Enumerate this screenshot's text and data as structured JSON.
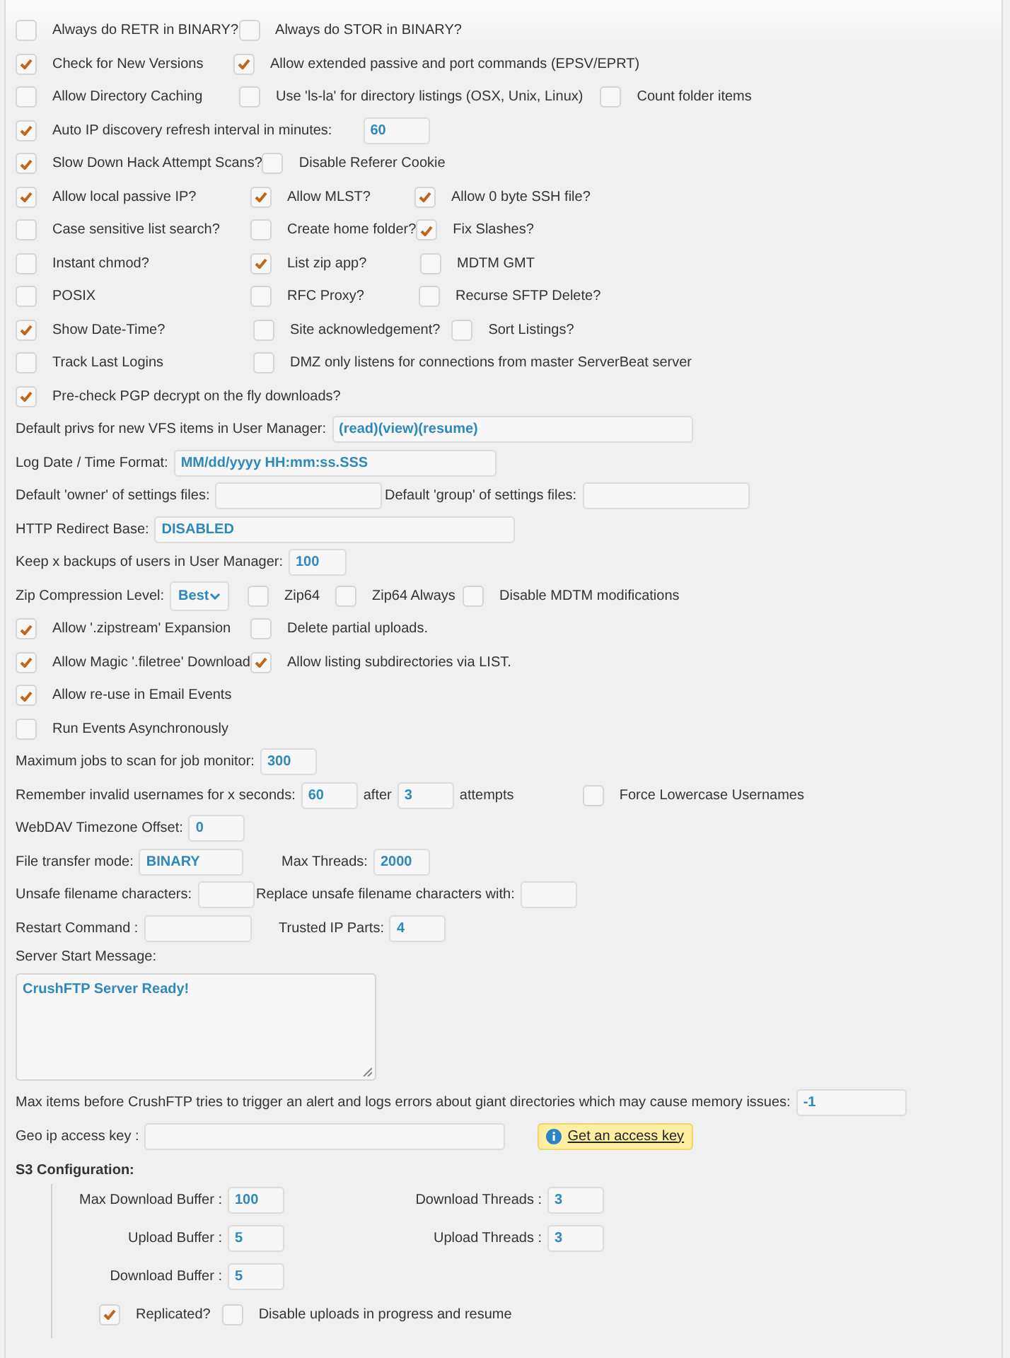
{
  "rows": [
    {
      "items": [
        {
          "kind": "checkbox",
          "label": "Always do RETR in BINARY?",
          "checked": false
        },
        {
          "kind": "checkbox",
          "label": "Always do STOR in BINARY?",
          "checked": false
        }
      ]
    },
    {
      "items": [
        {
          "kind": "checkbox",
          "label": "Check for New Versions",
          "checked": true
        },
        {
          "kind": "checkbox",
          "label": "Allow extended passive and port commands (EPSV/EPRT)",
          "checked": true
        }
      ]
    },
    {
      "items": [
        {
          "kind": "checkbox",
          "label": "Allow Directory Caching",
          "checked": false
        },
        {
          "kind": "checkbox",
          "label": "Use 'ls-la' for directory listings (OSX, Unix, Linux)",
          "checked": false
        },
        {
          "kind": "checkbox",
          "label": "Count folder items",
          "checked": false
        }
      ]
    },
    {
      "items": [
        {
          "kind": "checkbox",
          "label": "Auto IP discovery refresh interval in minutes:",
          "checked": true
        },
        {
          "kind": "field",
          "value": "60"
        }
      ]
    },
    {
      "items": [
        {
          "kind": "checkbox",
          "label": "Slow Down Hack Attempt Scans?",
          "checked": true
        },
        {
          "kind": "checkbox",
          "label": "Disable Referer Cookie",
          "checked": false
        }
      ]
    },
    {
      "items": [
        {
          "kind": "checkbox",
          "label": "Allow local passive IP?",
          "checked": true
        },
        {
          "kind": "checkbox",
          "label": "Allow MLST?",
          "checked": true
        },
        {
          "kind": "checkbox",
          "label": "Allow 0 byte SSH file?",
          "checked": true
        }
      ]
    },
    {
      "items": [
        {
          "kind": "checkbox",
          "label": "Case sensitive list search?",
          "checked": false
        },
        {
          "kind": "checkbox",
          "label": "Create home folder?",
          "checked": false
        },
        {
          "kind": "checkbox",
          "label": "Fix Slashes?",
          "checked": true
        }
      ]
    },
    {
      "items": [
        {
          "kind": "checkbox",
          "label": "Instant chmod?",
          "checked": false
        },
        {
          "kind": "checkbox",
          "label": "List zip app?",
          "checked": true
        },
        {
          "kind": "checkbox",
          "label": "MDTM GMT",
          "checked": false
        }
      ]
    },
    {
      "items": [
        {
          "kind": "checkbox",
          "label": "POSIX",
          "checked": false
        },
        {
          "kind": "checkbox",
          "label": "RFC Proxy?",
          "checked": false
        },
        {
          "kind": "checkbox",
          "label": "Recurse SFTP Delete?",
          "checked": false
        }
      ]
    },
    {
      "items": [
        {
          "kind": "checkbox",
          "label": "Show Date-Time?",
          "checked": true
        },
        {
          "kind": "checkbox",
          "label": "Site acknowledgement?",
          "checked": false
        },
        {
          "kind": "checkbox",
          "label": "Sort Listings?",
          "checked": false
        }
      ]
    },
    {
      "items": [
        {
          "kind": "checkbox",
          "label": "Track Last Logins",
          "checked": false
        },
        {
          "kind": "checkbox",
          "label": "DMZ only listens for connections from master ServerBeat server",
          "checked": false
        }
      ]
    },
    {
      "items": [
        {
          "kind": "checkbox",
          "label": "Pre-check PGP decrypt on the fly downloads?",
          "checked": true
        }
      ]
    },
    {
      "items": [
        {
          "kind": "field",
          "label": "Default privs for new VFS items in User Manager:",
          "value": "(read)(view)(resume)"
        }
      ]
    },
    {
      "items": [
        {
          "kind": "field",
          "label": "Log Date / Time Format:",
          "value": "MM/dd/yyyy HH:mm:ss.SSS"
        }
      ]
    },
    {
      "items": [
        {
          "kind": "field",
          "label": "Default 'owner' of settings files:"
        },
        {
          "kind": "field",
          "label": "Default 'group' of settings files:"
        }
      ]
    },
    {
      "items": [
        {
          "kind": "field",
          "label": "HTTP Redirect Base:",
          "value": "DISABLED"
        }
      ]
    },
    {
      "items": [
        {
          "kind": "field",
          "label": "Keep x backups of users in User Manager:",
          "value": "100"
        }
      ]
    },
    {
      "items": [
        {
          "kind": "select",
          "label": "Zip Compression Level:",
          "value": "Best"
        },
        {
          "kind": "checkbox",
          "label": "Zip64",
          "checked": false
        },
        {
          "kind": "checkbox",
          "label": "Zip64 Always",
          "checked": false
        },
        {
          "kind": "checkbox",
          "label": "Disable MDTM modifications",
          "checked": false
        }
      ]
    },
    {
      "items": [
        {
          "kind": "checkbox",
          "label": "Allow '.zipstream' Expansion",
          "checked": true
        },
        {
          "kind": "checkbox",
          "label": "Delete partial uploads.",
          "checked": false
        }
      ]
    },
    {
      "items": [
        {
          "kind": "checkbox",
          "label": "Allow Magic '.filetree' Download",
          "checked": true
        },
        {
          "kind": "checkbox",
          "label": "Allow listing subdirectories via LIST.",
          "checked": true
        }
      ]
    },
    {
      "items": [
        {
          "kind": "checkbox",
          "label": "Allow re-use in Email Events",
          "checked": true
        }
      ]
    },
    {
      "items": [
        {
          "kind": "checkbox",
          "label": "Run Events Asynchronously",
          "checked": false
        }
      ]
    },
    {
      "items": [
        {
          "kind": "field",
          "label": "Maximum jobs to scan for job monitor:",
          "value": "300"
        }
      ]
    },
    {
      "items": [
        {
          "kind": "field",
          "label": "Remember invalid usernames for x seconds:",
          "value": "60"
        },
        {
          "kind": "field",
          "label": "after",
          "value": "3"
        },
        {
          "kind": "text",
          "label": "attempts"
        },
        {
          "kind": "checkbox",
          "label": "Force Lowercase Usernames",
          "checked": false
        }
      ]
    },
    {
      "items": [
        {
          "kind": "field",
          "label": "WebDAV Timezone Offset:",
          "value": "0"
        }
      ]
    },
    {
      "items": [
        {
          "kind": "field",
          "label": "File transfer mode:",
          "value": "BINARY"
        },
        {
          "kind": "field",
          "label": "Max Threads:",
          "value": "2000"
        }
      ]
    },
    {
      "items": [
        {
          "kind": "field",
          "label": "Unsafe filename characters:"
        },
        {
          "kind": "field",
          "label": "Replace unsafe filename characters with:"
        }
      ]
    },
    {
      "items": [
        {
          "kind": "field",
          "label": "Restart Command  :"
        },
        {
          "kind": "field",
          "label": "Trusted IP Parts:",
          "value": "4"
        }
      ]
    },
    {
      "items": [
        {
          "kind": "textarea",
          "label": "Server Start Message:",
          "value": "CrushFTP Server Ready!"
        }
      ]
    },
    {
      "items": [
        {
          "kind": "field",
          "label": "Max items before CrushFTP tries to trigger an alert and logs errors about giant directories which may cause memory issues:",
          "value": "-1"
        }
      ]
    },
    {
      "items": [
        {
          "kind": "field",
          "label": "Geo ip access key  :"
        },
        {
          "kind": "link",
          "label": "Get an access key"
        }
      ]
    }
  ],
  "s3": {
    "title": "S3 Configuration:",
    "fields": [
      {
        "label": "Max Download Buffer :",
        "value": "100"
      },
      {
        "label": "Download Threads :",
        "value": "3"
      },
      {
        "label": "Upload Buffer :",
        "value": "5"
      },
      {
        "label": "Upload Threads :",
        "value": "3"
      },
      {
        "label": "Download Buffer :",
        "value": "5"
      }
    ],
    "options": [
      {
        "label": "Replicated?",
        "checked": true
      },
      {
        "label": "Disable uploads in progress and resume",
        "checked": false
      }
    ]
  }
}
